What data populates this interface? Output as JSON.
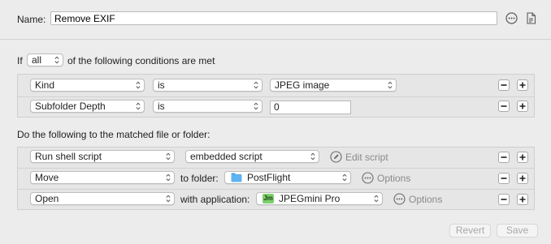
{
  "header": {
    "name_label": "Name:",
    "name_value": "Remove EXIF"
  },
  "conditions": {
    "if_label": "If",
    "match_mode": "all",
    "suffix": "of the following conditions are met",
    "rows": [
      {
        "attribute": "Kind",
        "operator": "is",
        "value": "JPEG image",
        "value_type": "popup"
      },
      {
        "attribute": "Subfolder Depth",
        "operator": "is",
        "value": "0",
        "value_type": "field"
      }
    ]
  },
  "actions": {
    "heading": "Do the following to the matched file or folder:",
    "rows": [
      {
        "action": "Run shell script",
        "param": "embedded script",
        "extra": "Edit script"
      },
      {
        "action": "Move",
        "connector": "to folder:",
        "target": "PostFlight",
        "extra": "Options"
      },
      {
        "action": "Open",
        "connector": "with application:",
        "target": "JPEGmini Pro",
        "extra": "Options",
        "target_icon_text": "Jm"
      }
    ]
  },
  "footer": {
    "revert": "Revert",
    "save": "Save"
  },
  "icons": {
    "more": "ellipsis-circle-icon",
    "notes": "document-icon",
    "edit": "pencil-circle-icon",
    "folder": "folder-icon",
    "app": "jpegmini-app-icon",
    "remove": "minus-icon",
    "add": "plus-icon"
  },
  "colors": {
    "folder_blue": "#5fb3f0",
    "app_green": "#7ccf6b"
  }
}
